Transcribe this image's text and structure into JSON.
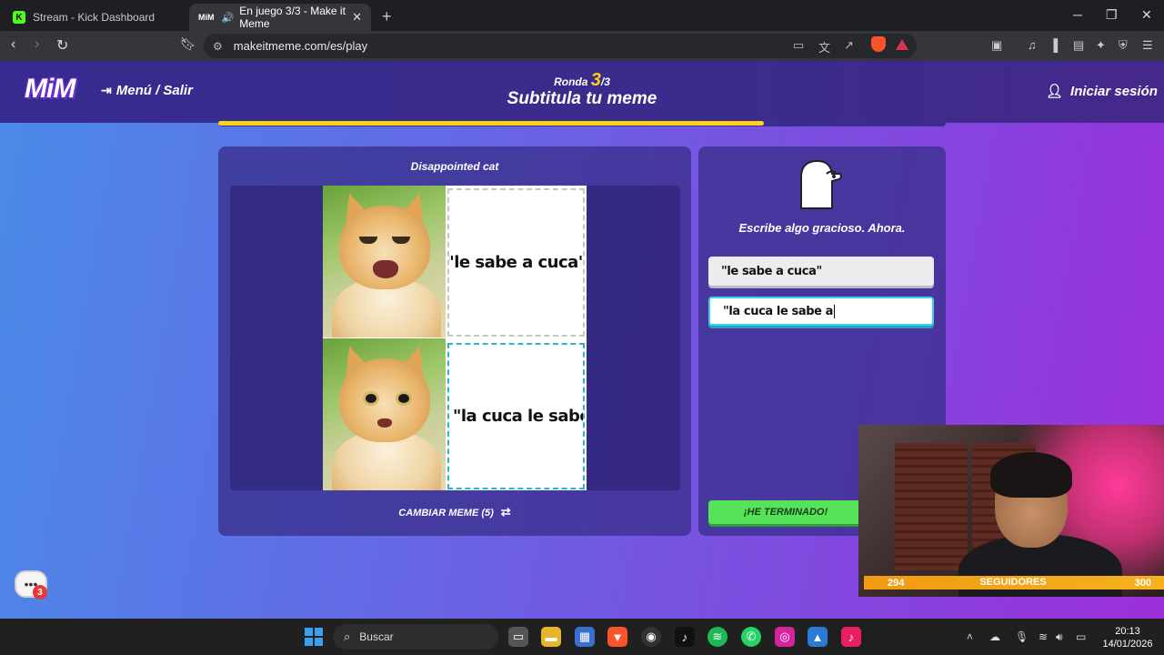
{
  "browser": {
    "tabs": [
      {
        "label": "Stream - Kick Dashboard",
        "favicon": "K",
        "active": false
      },
      {
        "label": "En juego 3/3 - Make it Meme",
        "favicon": "MiM",
        "active": true
      }
    ],
    "url": "makeitmeme.com/es/play",
    "brave_badge": "4"
  },
  "header": {
    "logo": "MiM",
    "menu_exit": "Menú / Salir",
    "round_word": "Ronda",
    "round_current": "3",
    "round_total": "/3",
    "title": "Subtitula tu meme",
    "login": "Iniciar sesión",
    "progress": 0.75
  },
  "meme": {
    "name": "Disappointed cat",
    "caption_1": "\"le sabe a cuca\"",
    "caption_2": "\"la cuca le sabe a",
    "change_label": "CAMBIAR MEME (5)"
  },
  "editor": {
    "prompt": "Escribe algo gracioso. Ahora.",
    "input_1_value": "\"le sabe a cuca\"",
    "input_2_value": "\"la cuca le sabe a",
    "done_label": "¡HE TERMINADO!"
  },
  "chat": {
    "badge": "3"
  },
  "stream_overlay": {
    "followers_current": "294",
    "followers_label": "SEGUIDORES",
    "followers_goal": "300"
  },
  "taskbar": {
    "search_placeholder": "Buscar",
    "time": "20:13",
    "date": "14/01/2026"
  },
  "colors": {
    "accent_yellow": "#ffd21a",
    "done_green": "#56e35a",
    "active_input_border": "#38d2f2",
    "follow_orange": "#f29a13"
  }
}
